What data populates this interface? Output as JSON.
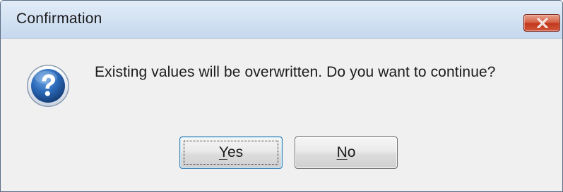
{
  "window": {
    "title": "Confirmation"
  },
  "icons": {
    "dialog_icon": "question-icon",
    "close_icon": "close-icon"
  },
  "message": {
    "text": "Existing values will be overwritten. Do you want to continue?"
  },
  "buttons": {
    "yes": {
      "mnemonic": "Y",
      "rest": "es"
    },
    "no": {
      "mnemonic": "N",
      "rest": "o"
    }
  },
  "colors": {
    "close_button": "#c2391d",
    "icon_blue": "#1f5fa8",
    "default_button_border": "#3c7fb1"
  }
}
